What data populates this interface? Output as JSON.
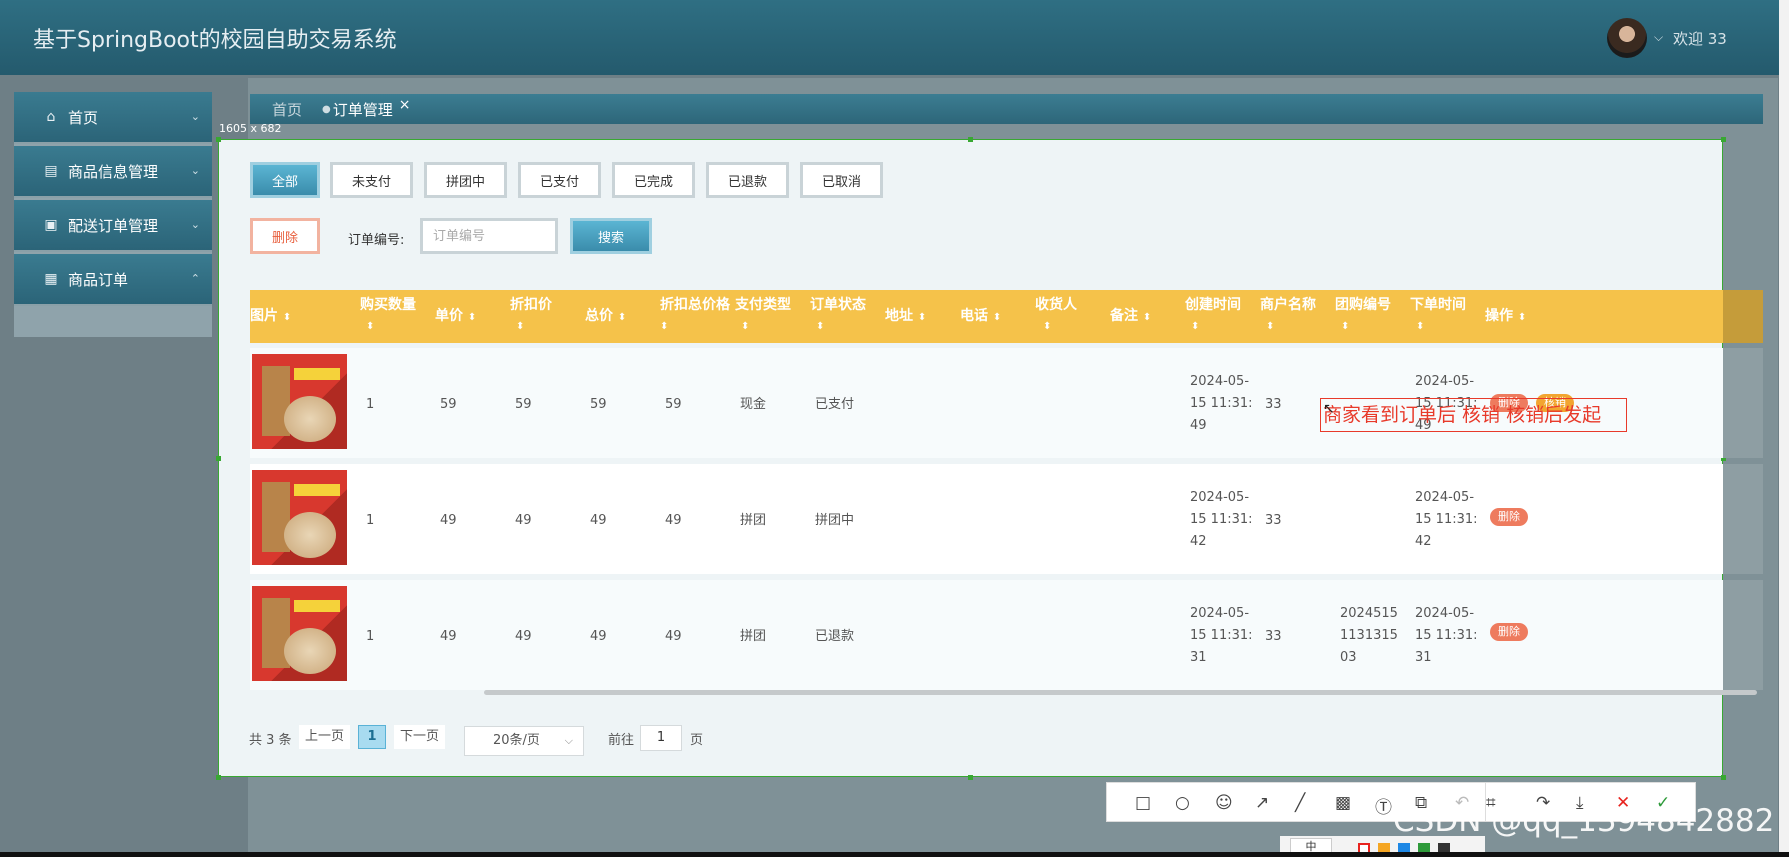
{
  "header": {
    "title": "基于SpringBoot的校园自助交易系统",
    "welcome": "欢迎 33"
  },
  "sidebar": {
    "items": [
      {
        "label": "首页",
        "icon": "home-icon",
        "chev": "⌄"
      },
      {
        "label": "商品信息管理",
        "icon": "table-icon",
        "chev": "⌄"
      },
      {
        "label": "配送订单管理",
        "icon": "bag-icon",
        "chev": "⌄"
      },
      {
        "label": "商品订单",
        "icon": "server-icon",
        "chev": "⌃"
      }
    ]
  },
  "breadcrumb": {
    "home": "首页",
    "current": "订单管理",
    "close": "×"
  },
  "capture": {
    "size_label": "1605 x 682"
  },
  "status_tabs": [
    "全部",
    "未支付",
    "拼团中",
    "已支付",
    "已完成",
    "已退款",
    "已取消"
  ],
  "actions": {
    "delete": "删除",
    "search_label": "订单编号:",
    "search_placeholder": "订单编号",
    "search_button": "搜索"
  },
  "table": {
    "columns": [
      "图片",
      "购买数量",
      "单价",
      "折扣价",
      "总价",
      "折扣总价格",
      "支付类型",
      "订单状态",
      "地址",
      "电话",
      "收货人",
      "备注",
      "创建时间",
      "商户名称",
      "团购编号",
      "下单时间",
      "操作"
    ],
    "rows": [
      {
        "qty": "1",
        "price": "59",
        "disc": "59",
        "total": "59",
        "disc_total": "59",
        "pay": "现金",
        "status": "已支付",
        "created": [
          "2024-05-",
          "15 11:31:",
          "49"
        ],
        "merchant": "33",
        "group": [
          "",
          "",
          ""
        ],
        "ordered": [
          "2024-05-",
          "15 11:31:",
          "49"
        ],
        "ops": [
          "删除",
          "核销"
        ]
      },
      {
        "qty": "1",
        "price": "49",
        "disc": "49",
        "total": "49",
        "disc_total": "49",
        "pay": "拼团",
        "status": "拼团中",
        "created": [
          "2024-05-",
          "15 11:31:",
          "42"
        ],
        "merchant": "33",
        "group": [
          "",
          "",
          ""
        ],
        "ordered": [
          "2024-05-",
          "15 11:31:",
          "42"
        ],
        "ops": [
          "删除"
        ]
      },
      {
        "qty": "1",
        "price": "49",
        "disc": "49",
        "total": "49",
        "disc_total": "49",
        "pay": "拼团",
        "status": "已退款",
        "created": [
          "2024-05-",
          "15 11:31:",
          "31"
        ],
        "merchant": "33",
        "group": [
          "2024515",
          "1131315",
          "03"
        ],
        "ordered": [
          "2024-05-",
          "15 11:31:",
          "31"
        ],
        "ops": [
          "删除"
        ]
      }
    ]
  },
  "annotation": "商家看到订单后 核销 核销后发起",
  "pagination": {
    "total": "共 3 条",
    "prev": "上一页",
    "current": "1",
    "next": "下一页",
    "page_size": "20条/页",
    "goto": "前往",
    "goto_value": "1",
    "page": "页"
  },
  "snip_toolbar": {
    "font_size": "中",
    "swatches": [
      "#e8231e",
      "#f5a623",
      "#1e88e5",
      "#2e9a3a",
      "#333333"
    ]
  },
  "watermark": "CSDN @qq_1394842882"
}
